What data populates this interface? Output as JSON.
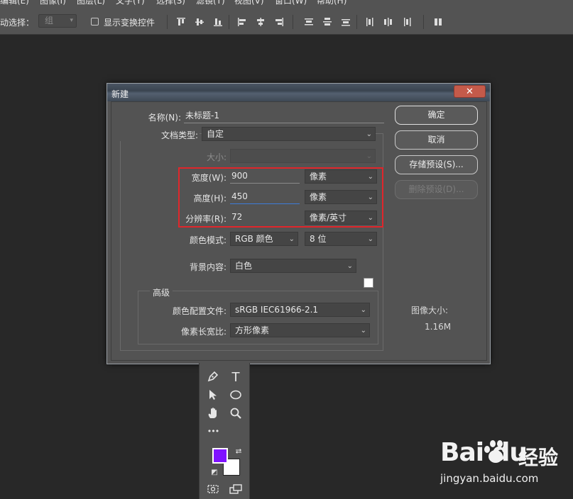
{
  "menubar": {
    "items": [
      "编辑(E)",
      "图像(I)",
      "图层(L)",
      "文字(Y)",
      "选择(S)",
      "滤镜(T)",
      "视图(V)",
      "窗口(W)",
      "帮助(H)"
    ]
  },
  "options_bar": {
    "auto_select_label": "动选择：",
    "auto_select_value": "组",
    "show_transform_label": "显示变换控件"
  },
  "dialog": {
    "title": "新建",
    "close_icon": "close-icon",
    "name_label": "名称(N):",
    "name_value": "未标题-1",
    "doc_type_label": "文档类型:",
    "doc_type_value": "自定",
    "size_label": "大小:",
    "size_value": "",
    "width_label": "宽度(W):",
    "width_value": "900",
    "width_unit": "像素",
    "height_label": "高度(H):",
    "height_value": "450",
    "height_unit": "像素",
    "resolution_label": "分辨率(R):",
    "resolution_value": "72",
    "resolution_unit": "像素/英寸",
    "color_mode_label": "颜色模式:",
    "color_mode_value": "RGB 颜色",
    "bit_depth_value": "8 位",
    "background_label": "背景内容:",
    "background_value": "白色",
    "advanced_label": "高级",
    "color_profile_label": "颜色配置文件:",
    "color_profile_value": "sRGB IEC61966-2.1",
    "pixel_aspect_label": "像素长宽比:",
    "pixel_aspect_value": "方形像素",
    "buttons": {
      "ok": "确定",
      "cancel": "取消",
      "save_preset": "存储预设(S)...",
      "delete_preset": "删除预设(D)..."
    },
    "image_size_label": "图像大小:",
    "image_size_value": "1.16M"
  },
  "toolbar": {
    "tools": [
      "pen-icon",
      "type-icon",
      "path-select-icon",
      "ellipse-icon",
      "hand-icon",
      "zoom-icon",
      "more-icon"
    ],
    "type_glyph": "T",
    "more_glyph": "•••",
    "foreground_color": "#7f12ff",
    "background_color": "#ffffff"
  },
  "watermark": {
    "logo_text": "Bai du",
    "logo_cn": "经验",
    "url": "jingyan.baidu.com"
  },
  "colors": {
    "highlight_box": "#e0262b",
    "dialog_bg": "#535353",
    "workspace_bg": "#282828"
  }
}
